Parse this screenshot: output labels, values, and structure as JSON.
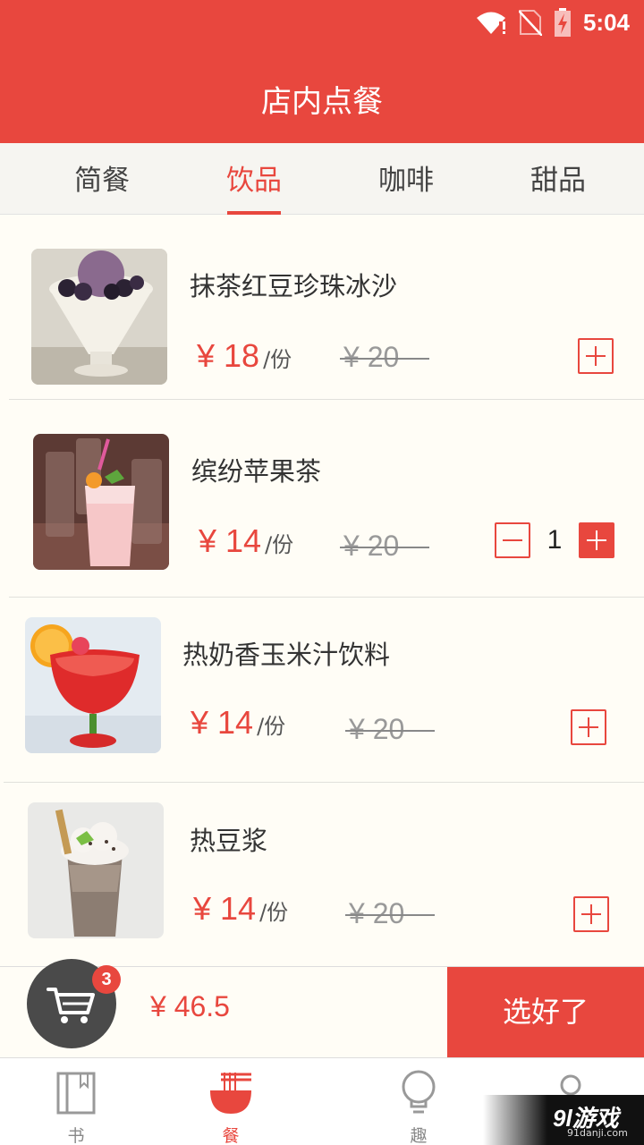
{
  "status_bar": {
    "time": "5:04",
    "icons": [
      "wifi-alert-icon",
      "no-sim-icon",
      "battery-charging-icon"
    ]
  },
  "header": {
    "title": "店内点餐"
  },
  "tabs": [
    {
      "label": "简餐",
      "active": false
    },
    {
      "label": "饮品",
      "active": true
    },
    {
      "label": "咖啡",
      "active": false
    },
    {
      "label": "甜品",
      "active": false
    }
  ],
  "items": [
    {
      "name": "抹茶红豆珍珠冰沙",
      "price": "¥ 18",
      "unit": "/份",
      "old_price": "¥ 20",
      "quantity": null
    },
    {
      "name": "缤纷苹果茶",
      "price": "¥ 14",
      "unit": "/份",
      "old_price": "¥ 20",
      "quantity": "1"
    },
    {
      "name": "热奶香玉米汁饮料",
      "price": "¥ 14",
      "unit": "/份",
      "old_price": "¥ 20",
      "quantity": null
    },
    {
      "name": "热豆浆",
      "price": "¥ 14",
      "unit": "/份",
      "old_price": "¥ 20",
      "quantity": null
    }
  ],
  "cart": {
    "count": "3",
    "total": "¥ 46.5",
    "checkout_label": "选好了"
  },
  "bottom_nav": [
    {
      "label": "书",
      "icon": "book-icon",
      "active": false
    },
    {
      "label": "餐",
      "icon": "noodle-bowl-icon",
      "active": true
    },
    {
      "label": "趣",
      "icon": "lightbulb-icon",
      "active": false
    },
    {
      "label": "",
      "icon": "profile-icon",
      "active": false
    }
  ],
  "watermark": {
    "logo": "9l游戏",
    "url": "91danji.com"
  },
  "colors": {
    "accent": "#e8473e",
    "background": "#fffdf6",
    "cart_button": "#4a4a4a"
  }
}
